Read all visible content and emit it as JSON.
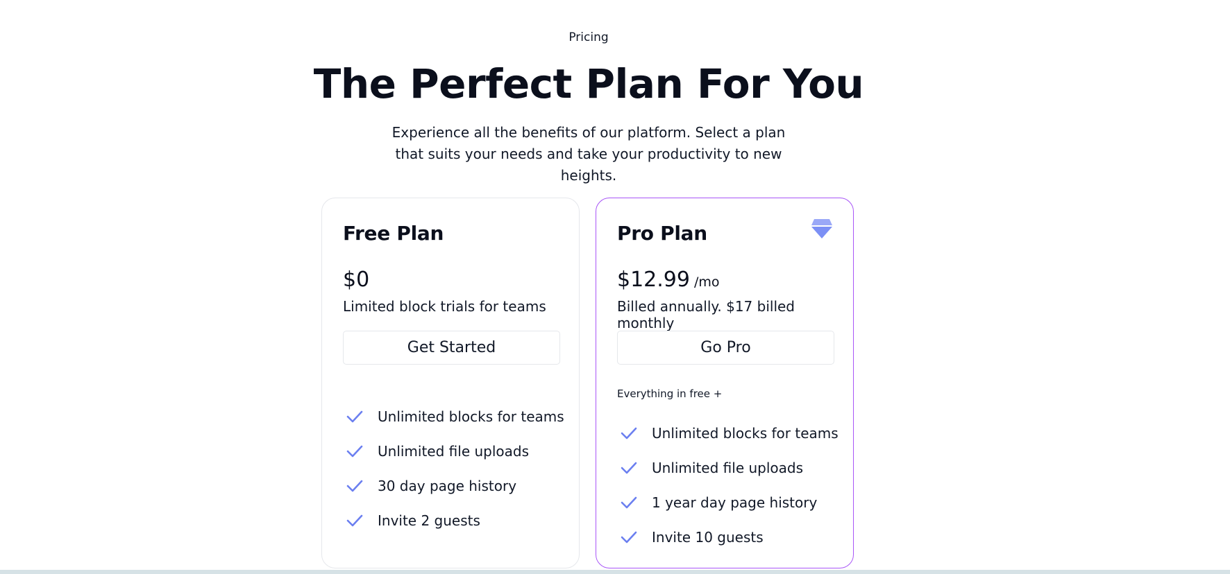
{
  "header": {
    "eyebrow": "Pricing",
    "title": "The Perfect Plan For You",
    "subtitle": "Experience all the benefits of our platform. Select a plan that suits your needs and take your productivity to new heights."
  },
  "plans": [
    {
      "name": "Free Plan",
      "price": "$0",
      "price_suffix": "",
      "note": "Limited block trials for teams",
      "cta": "Get Started",
      "intro": "",
      "features": [
        "Unlimited blocks for teams",
        "Unlimited file uploads",
        "30 day page history",
        "Invite 2 guests"
      ]
    },
    {
      "name": "Pro Plan",
      "price": "$12.99",
      "price_suffix": "/mo",
      "note": "Billed annually. $17 billed monthly",
      "cta": "Go Pro",
      "intro": "Everything in free +",
      "icon": "diamond-icon",
      "features": [
        "Unlimited blocks for teams",
        "Unlimited file uploads",
        "1 year day page history",
        "Invite 10 guests"
      ]
    }
  ],
  "colors": {
    "accent_border": "#a855f7",
    "check": "#6b7ff0",
    "gem": "#7c90f5"
  }
}
